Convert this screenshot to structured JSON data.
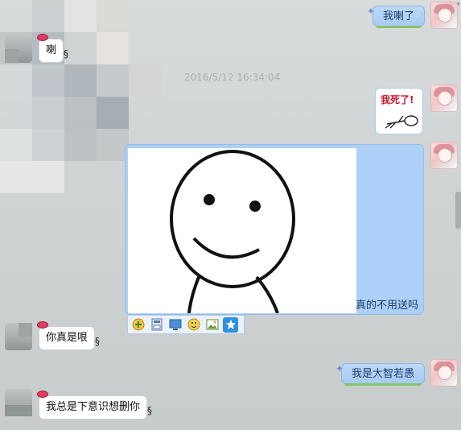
{
  "conversation": {
    "timestamp": "2016/5/12 16:34:04",
    "messages": [
      {
        "side": "right",
        "text": "我喇了"
      },
      {
        "side": "left",
        "text": "喇"
      },
      {
        "side": "right",
        "type": "sticker",
        "text": "我死了!"
      },
      {
        "side": "right",
        "type": "image",
        "caption": "真的不用送吗"
      },
      {
        "side": "left",
        "text": "你真是哏"
      },
      {
        "side": "right",
        "text": "我是大智若愚"
      },
      {
        "side": "left",
        "text": "我总是下意识想删你"
      }
    ]
  },
  "image_toolbar": {
    "buttons": [
      "add-emoji-icon",
      "save-icon",
      "screen-icon",
      "emoticon-icon",
      "picture-icon",
      "favorite-icon"
    ]
  },
  "colors": {
    "bubble_right": "#acd0f7",
    "bubble_left": "#ffffff",
    "bubble_underline": "#86c46a",
    "sticker_text": "#c8132b"
  }
}
